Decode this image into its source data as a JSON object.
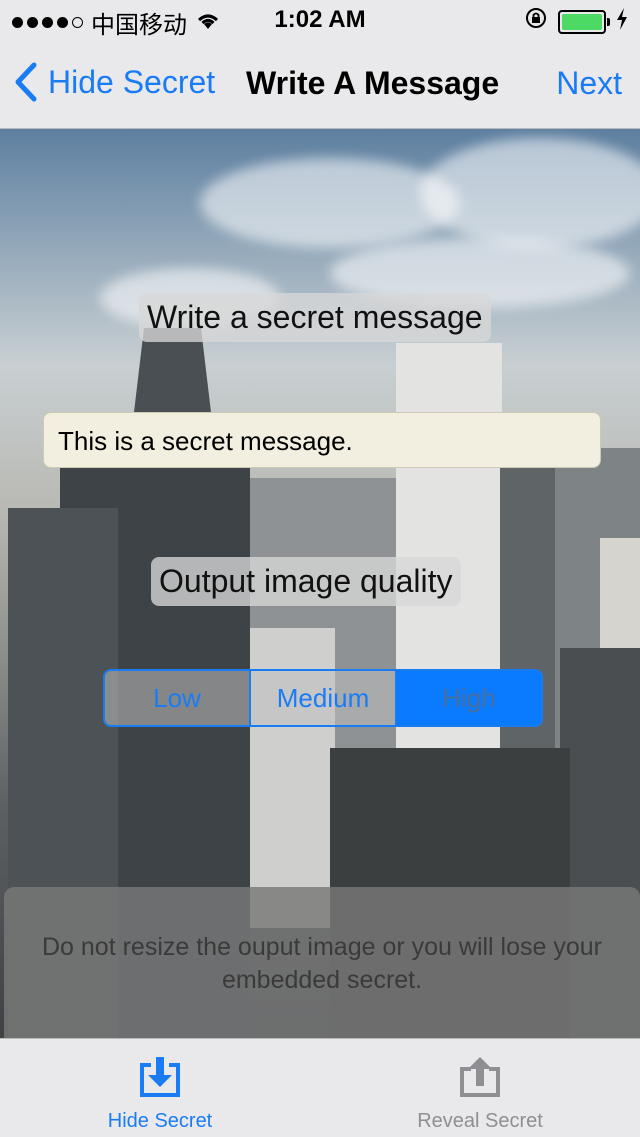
{
  "status_bar": {
    "carrier": "中国移动",
    "time": "1:02 AM",
    "signal_bars_filled": 4,
    "signal_bars_total": 5,
    "battery_level": 1.0,
    "icons": [
      "wifi-icon",
      "rotation-lock-icon",
      "battery-icon",
      "charging-icon"
    ]
  },
  "nav": {
    "back_label": "Hide Secret",
    "title": "Write A Message",
    "next_label": "Next"
  },
  "form": {
    "message_heading": "Write a secret message",
    "message_value": "This is a secret message.",
    "quality_heading": "Output image quality",
    "quality_options": [
      "Low",
      "Medium",
      "High"
    ],
    "quality_selected": "High"
  },
  "warning": {
    "line1": "Do not resize the ouput image or you will lose your",
    "line2": "embedded secret."
  },
  "tabs": [
    {
      "label": "Hide Secret",
      "icon": "download-tray-icon",
      "active": true
    },
    {
      "label": "Reveal Secret",
      "icon": "upload-tray-icon",
      "active": false
    }
  ],
  "colors": {
    "accent": "#1a7cf5",
    "bar_background": "#e9e9eb",
    "input_background": "#f3efe0",
    "inactive_tab": "#8e8e93"
  }
}
